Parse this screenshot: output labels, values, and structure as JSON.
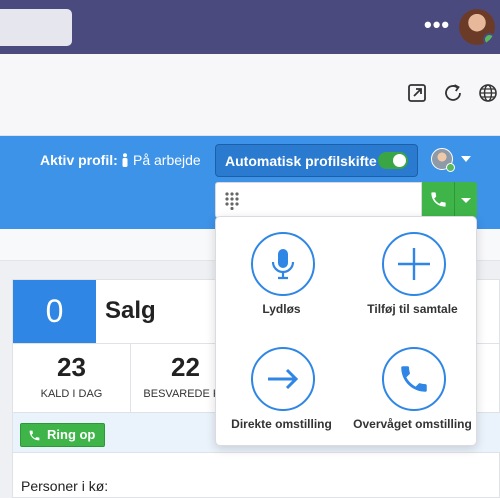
{
  "topbar": {
    "more_icon": "more-horizontal-icon",
    "avatar": "user-avatar"
  },
  "toolbar": {
    "icons": [
      "open-external-icon",
      "refresh-icon",
      "globe-icon"
    ]
  },
  "header": {
    "active_profile_label": "Aktiv profil:",
    "active_profile_value": "På arbejde",
    "auto_switch_label": "Automatisk profilskifte",
    "auto_switch_on": true,
    "dial_placeholder": "",
    "colors": {
      "header_blue": "#3d93e8",
      "call_green": "#3fb549"
    }
  },
  "queue": {
    "count": "0",
    "name": "Salg",
    "stats": [
      {
        "value": "23",
        "label": "KALD I DAG"
      },
      {
        "value": "22",
        "label": "BESVAREDE KA"
      }
    ],
    "ring_label": "Ring op",
    "persons_label": "Personer i kø:"
  },
  "call_menu": {
    "actions": [
      {
        "label": "Lydløs",
        "icon": "microphone-icon"
      },
      {
        "label": "Tilføj til samtale",
        "icon": "plus-icon"
      },
      {
        "label": "Direkte omstilling",
        "icon": "arrow-right-icon"
      },
      {
        "label": "Overvåget omstilling",
        "icon": "phone-icon"
      }
    ]
  }
}
